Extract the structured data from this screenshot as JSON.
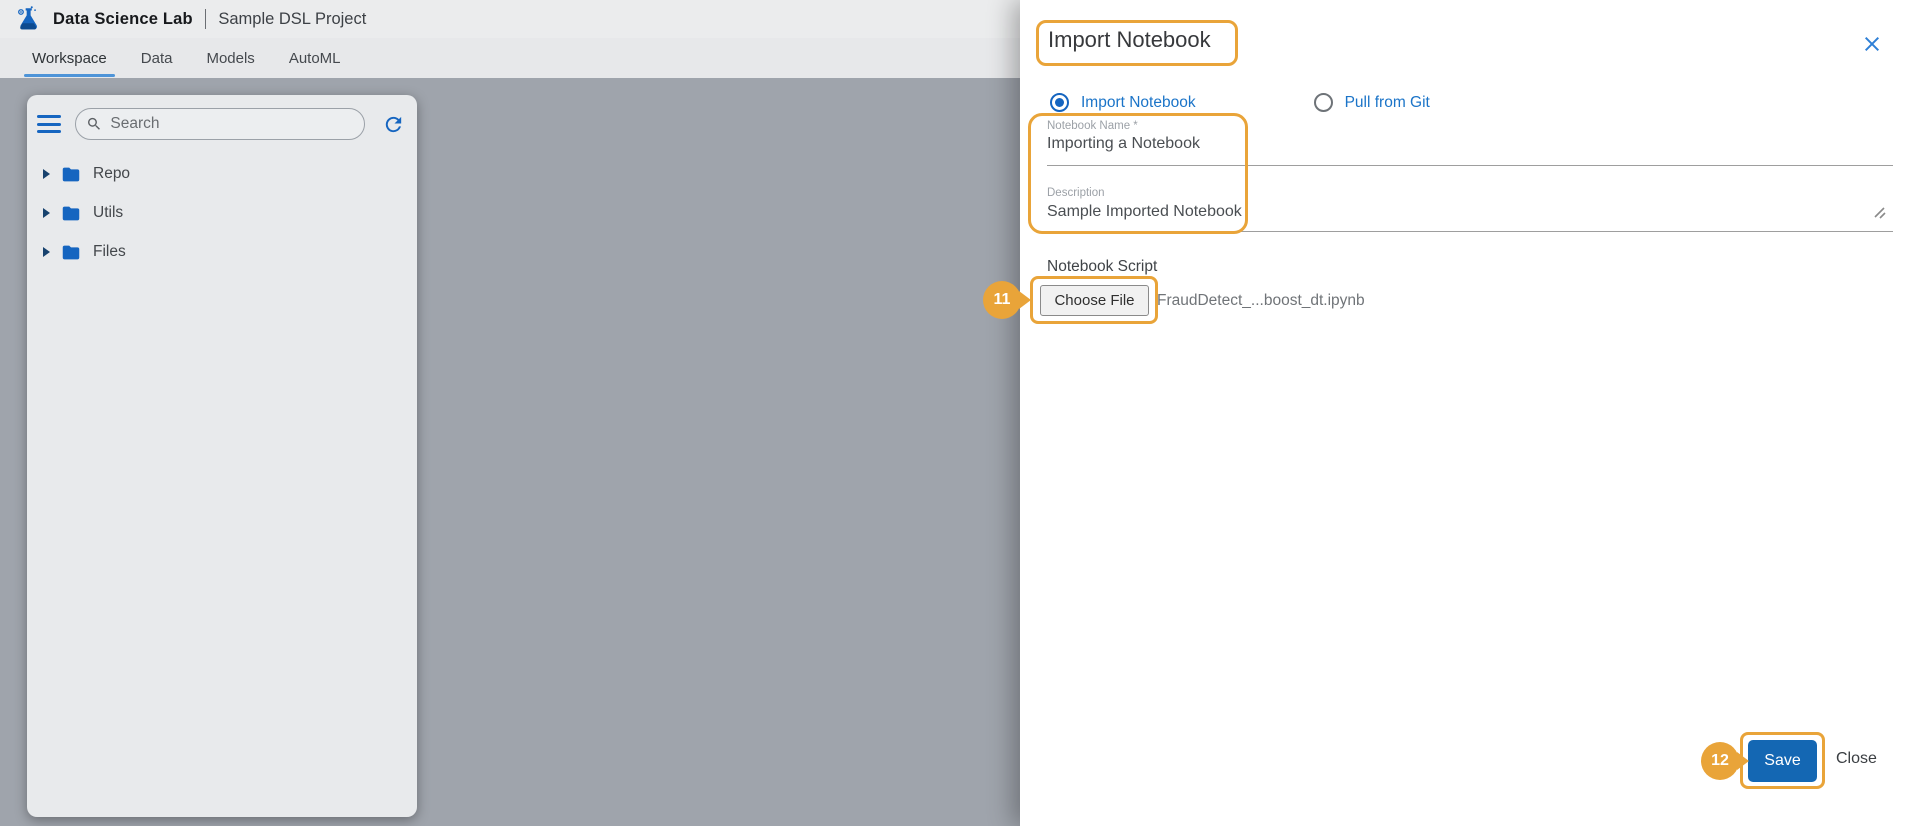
{
  "header": {
    "app_title": "Data Science Lab",
    "project_title": "Sample DSL Project",
    "logo_icon": "flask-atom-icon"
  },
  "tabs": [
    {
      "label": "Workspace",
      "active": true
    },
    {
      "label": "Data",
      "active": false
    },
    {
      "label": "Models",
      "active": false
    },
    {
      "label": "AutoML",
      "active": false
    }
  ],
  "sidebar": {
    "menu_icon": "hamburger-icon",
    "search_placeholder": "Search",
    "search_icon": "search-icon",
    "refresh_icon": "refresh-icon",
    "tree": [
      {
        "label": "Repo",
        "expand_icon": "chevron-right-icon",
        "folder_icon": "folder-icon"
      },
      {
        "label": "Utils",
        "expand_icon": "chevron-right-icon",
        "folder_icon": "folder-icon"
      },
      {
        "label": "Files",
        "expand_icon": "chevron-right-icon",
        "folder_icon": "folder-icon"
      }
    ]
  },
  "dialog": {
    "title": "Import Notebook",
    "close_icon": "close-x-icon",
    "radio_options": [
      {
        "label": "Import Notebook",
        "selected": true
      },
      {
        "label": "Pull from Git",
        "selected": false
      }
    ],
    "fields": {
      "notebook_name": {
        "label": "Notebook Name *",
        "value": "Importing a Notebook"
      },
      "description": {
        "label": "Description",
        "value": "Sample Imported Notebook",
        "resize_icon": "resize-handle-icon"
      }
    },
    "script": {
      "label": "Notebook Script",
      "choose_file_label": "Choose File",
      "file_name": "FraudDetect_...boost_dt.ipynb"
    },
    "annotations": [
      {
        "step": "11",
        "target": "choose-file-button"
      },
      {
        "step": "12",
        "target": "save-button"
      }
    ],
    "footer": {
      "save_label": "Save",
      "close_label": "Close"
    }
  },
  "colors": {
    "accent_blue": "#1565c0",
    "save_button_blue": "#1467b3",
    "highlight_orange": "#e9a439",
    "backdrop_gray": "#9fa4ac",
    "sidebar_gray": "#e8eaec",
    "tab_underline_blue": "#4e94d8"
  }
}
